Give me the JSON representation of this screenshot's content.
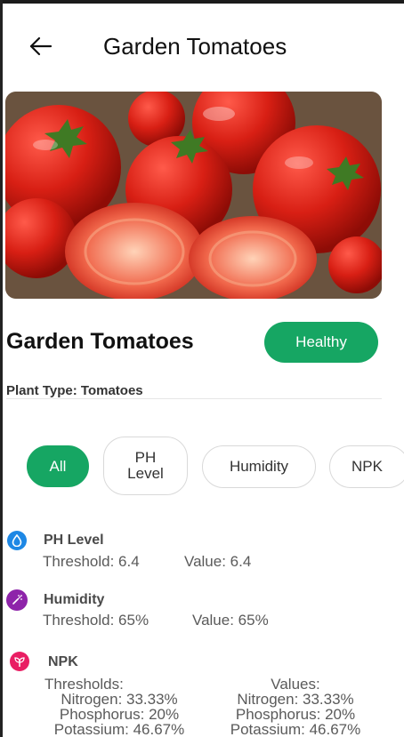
{
  "header": {
    "title": "Garden Tomatoes"
  },
  "plant": {
    "name": "Garden Tomatoes",
    "status": "Healthy",
    "type_label": "Plant Type:",
    "type_value": "Tomatoes"
  },
  "filters": [
    {
      "label": "All",
      "active": true
    },
    {
      "label": "PH",
      "label2": "Level",
      "active": false
    },
    {
      "label": "Humidity",
      "active": false
    },
    {
      "label": "NPK",
      "active": false
    }
  ],
  "sensors": {
    "ph": {
      "title": "PH Level",
      "threshold": "Threshold: 6.4",
      "value": "Value: 6.4",
      "icon": "water-drop-icon"
    },
    "humidity": {
      "title": "Humidity",
      "threshold": "Threshold: 65%",
      "value": "Value: 65%",
      "icon": "sprinkler-icon"
    },
    "npk": {
      "title": "NPK",
      "icon": "seedling-icon",
      "thresholds_label": "Thresholds:",
      "values_label": "Values:",
      "thresholds": [
        "Nitrogen: 33.33%",
        "Phosphorus: 20%",
        "Potassium: 46.67%"
      ],
      "values": [
        "Nitrogen: 33.33%",
        "Phosphorus: 20%",
        "Potassium: 46.67%"
      ]
    }
  },
  "colors": {
    "accent": "#16a663",
    "ph_icon": "#1e88e5",
    "humidity_icon": "#8e24aa",
    "npk_icon": "#e91e63"
  }
}
